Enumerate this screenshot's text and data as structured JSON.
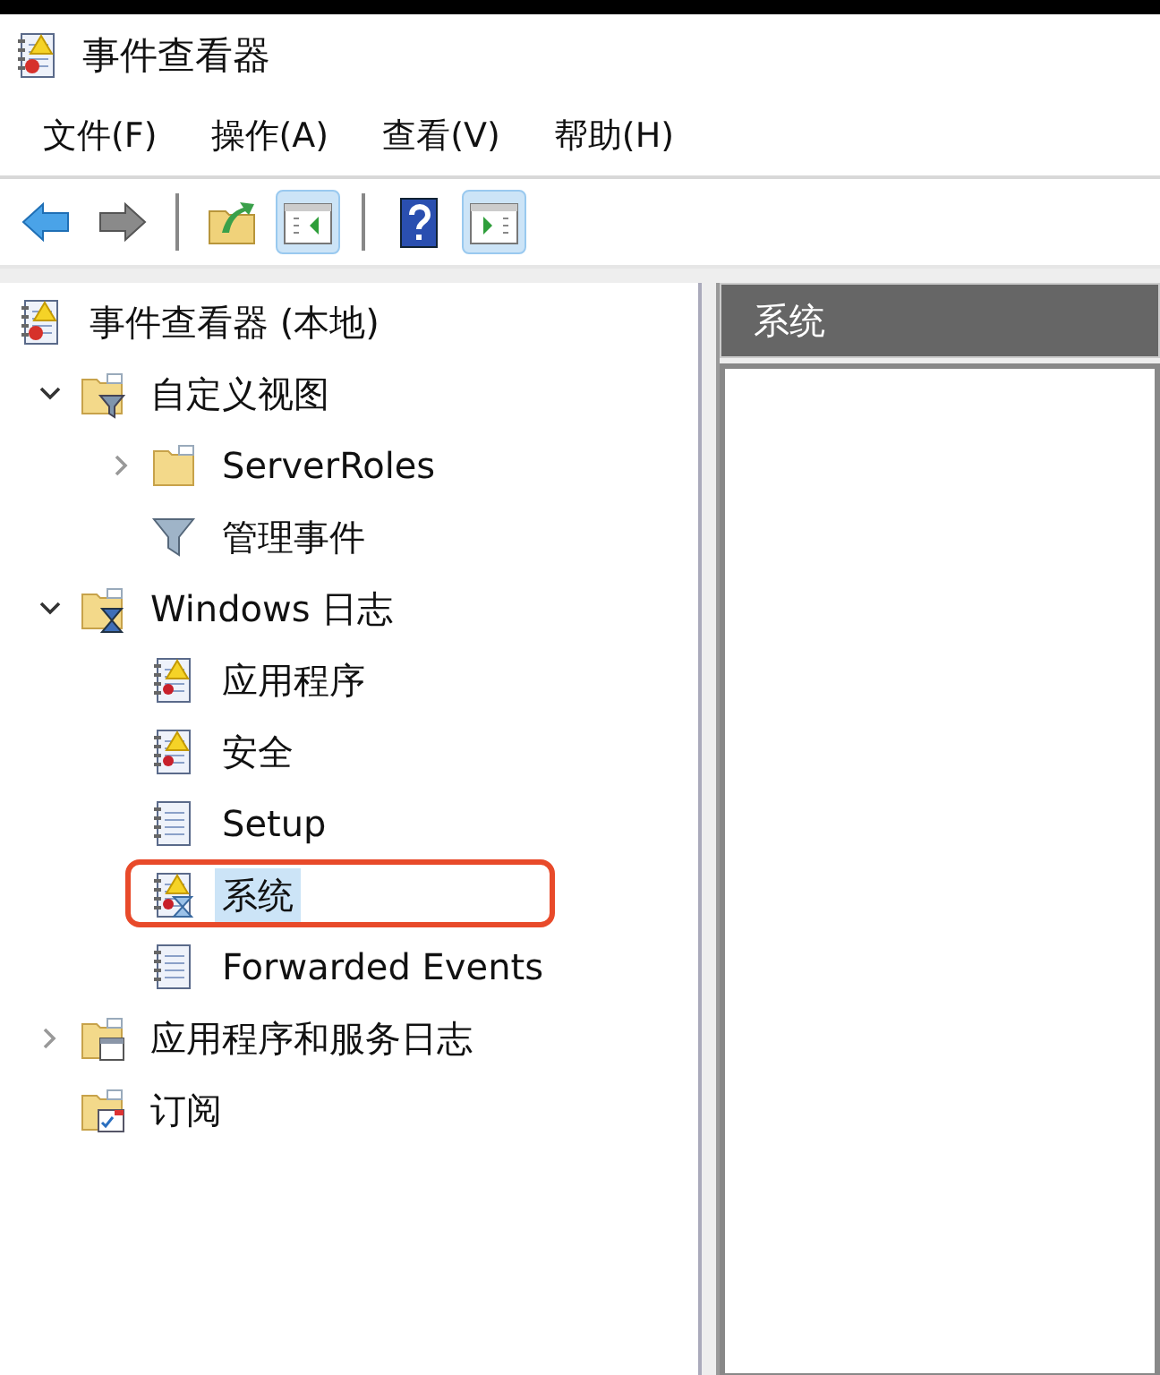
{
  "window": {
    "title": "事件查看器"
  },
  "menu": [
    {
      "label": "文件(F)"
    },
    {
      "label": "操作(A)"
    },
    {
      "label": "查看(V)"
    },
    {
      "label": "帮助(H)"
    }
  ],
  "toolbar": [
    {
      "kind": "back",
      "on": false
    },
    {
      "kind": "forward",
      "on": false
    },
    {
      "kind": "separator"
    },
    {
      "kind": "up",
      "on": false
    },
    {
      "kind": "treepane",
      "on": true
    },
    {
      "kind": "separator"
    },
    {
      "kind": "help",
      "on": false
    },
    {
      "kind": "actionpane",
      "on": true
    }
  ],
  "tree": [
    {
      "label": "事件查看器 (本地)",
      "kind": "root",
      "selected": false,
      "children": [
        {
          "label": "自定义视图",
          "kind": "views",
          "expanded": true,
          "selected": false,
          "children": [
            {
              "label": "ServerRoles",
              "kind": "folder",
              "expanded": false,
              "selected": false
            },
            {
              "label": "管理事件",
              "kind": "filter",
              "selected": false
            }
          ]
        },
        {
          "label": "Windows 日志",
          "kind": "winlogs",
          "expanded": true,
          "selected": false,
          "children": [
            {
              "label": "应用程序",
              "kind": "warnlog",
              "selected": false
            },
            {
              "label": "安全",
              "kind": "warnlog",
              "selected": false
            },
            {
              "label": "Setup",
              "kind": "log",
              "selected": false
            },
            {
              "label": "系统",
              "kind": "syslog",
              "selected": true,
              "annotated": true
            },
            {
              "label": "Forwarded Events",
              "kind": "log",
              "selected": false
            }
          ]
        },
        {
          "label": "应用程序和服务日志",
          "kind": "appfolder",
          "expanded": false,
          "selected": false
        },
        {
          "label": "订阅",
          "kind": "subs",
          "selected": false
        }
      ]
    }
  ],
  "pane": {
    "title": "系统"
  }
}
